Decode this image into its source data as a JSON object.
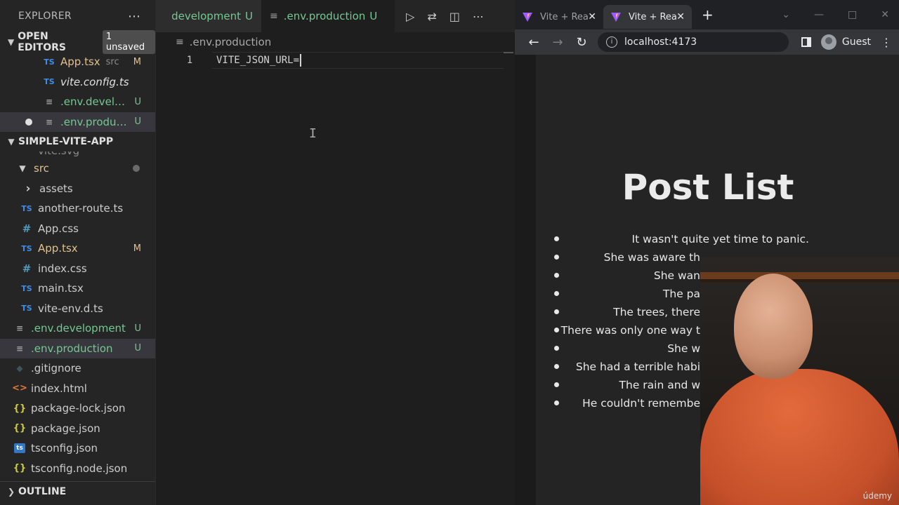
{
  "sidebar": {
    "title": "EXPLORER",
    "more": "⋯",
    "open_editors": {
      "label": "OPEN EDITORS",
      "badge": "1 unsaved",
      "items": [
        {
          "icon": "TS",
          "name": "App.tsx",
          "hint": "src",
          "status": "M"
        },
        {
          "icon": "TS",
          "name": "vite.config.ts",
          "status": ""
        },
        {
          "icon": "≡",
          "name": ".env.develo...",
          "status": "U"
        },
        {
          "icon": "≡",
          "name": ".env.produc...",
          "status": "U"
        }
      ]
    },
    "project": {
      "label": "SIMPLE-VITE-APP",
      "cut_off_item": "vite.svg",
      "items": [
        {
          "icon": "›",
          "name": "src",
          "status": ""
        },
        {
          "icon": "›",
          "name": "assets",
          "status": ""
        },
        {
          "icon": "TS",
          "name": "another-route.ts",
          "status": ""
        },
        {
          "icon": "#",
          "name": "App.css",
          "status": ""
        },
        {
          "icon": "TS",
          "name": "App.tsx",
          "status": "M"
        },
        {
          "icon": "#",
          "name": "index.css",
          "status": ""
        },
        {
          "icon": "TS",
          "name": "main.tsx",
          "status": ""
        },
        {
          "icon": "TS",
          "name": "vite-env.d.ts",
          "status": ""
        },
        {
          "icon": "≡",
          "name": ".env.development",
          "status": "U"
        },
        {
          "icon": "≡",
          "name": ".env.production",
          "status": "U"
        },
        {
          "icon": "◆",
          "name": ".gitignore",
          "status": ""
        },
        {
          "icon": "<>",
          "name": "index.html",
          "status": ""
        },
        {
          "icon": "{}",
          "name": "package-lock.json",
          "status": ""
        },
        {
          "icon": "{}",
          "name": "package.json",
          "status": ""
        },
        {
          "icon": "ts",
          "name": "tsconfig.json",
          "status": ""
        },
        {
          "icon": "{}",
          "name": "tsconfig.node.json",
          "status": ""
        }
      ]
    },
    "outline_label": "OUTLINE"
  },
  "editor": {
    "tabs": [
      {
        "label": "development",
        "status": "U"
      },
      {
        "label": ".env.production",
        "status": "U"
      }
    ],
    "breadcrumb": ".env.production",
    "lines": [
      {
        "number": "1",
        "text": "VITE_JSON_URL="
      }
    ],
    "ibeam": "I"
  },
  "browser": {
    "tabs": [
      {
        "title": "Vite + Rea"
      },
      {
        "title": "Vite + Rea"
      }
    ],
    "url": "localhost:4173",
    "profile": "Guest",
    "page": {
      "title": "Post List",
      "posts": [
        "It wasn't quite yet time to panic.",
        "She was aware th",
        "She wan",
        "The pa",
        "The trees, there",
        "There was only one way t",
        "She w",
        "She had a terrible habi",
        "The rain and w",
        "He couldn't remembe"
      ]
    }
  },
  "watermark": "údemy",
  "colors": {
    "accent_untracked": "#73c991",
    "accent_modified": "#e2c08d",
    "sidebar_bg": "#252526",
    "editor_bg": "#1e1e1e",
    "browser_bg": "#242424"
  }
}
